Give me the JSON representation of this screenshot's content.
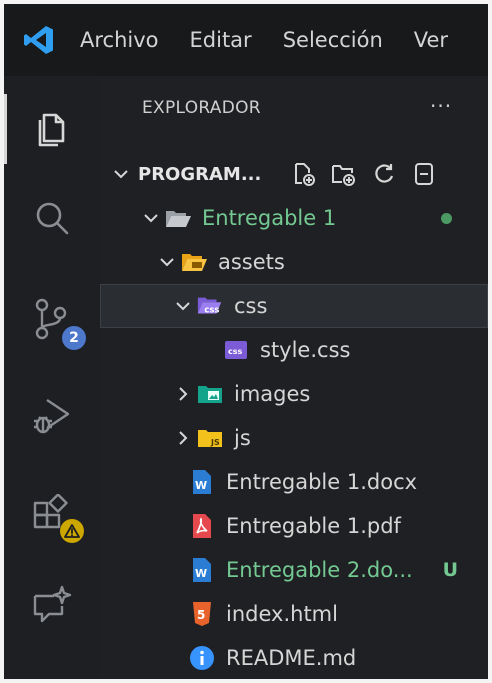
{
  "menubar": {
    "items": [
      "Archivo",
      "Editar",
      "Selección",
      "Ver"
    ]
  },
  "activity_bar": {
    "items": [
      {
        "icon": "explorer-icon",
        "active": true
      },
      {
        "icon": "search-icon"
      },
      {
        "icon": "source-control-icon",
        "badge": "2"
      },
      {
        "icon": "run-debug-icon"
      },
      {
        "icon": "extensions-icon",
        "badge": "!"
      },
      {
        "icon": "chat-icon"
      }
    ]
  },
  "sidebar": {
    "title": "EXPLORADOR",
    "more": "···",
    "section": "PROGRAM...",
    "tree": [
      {
        "name": "Entregable 1",
        "type": "folder-open",
        "depth": 1,
        "git": "dot"
      },
      {
        "name": "assets",
        "type": "folder-open",
        "depth": 2
      },
      {
        "name": "css",
        "type": "folder-css",
        "depth": 3,
        "selected": true
      },
      {
        "name": "style.css",
        "type": "css-file",
        "depth": 4
      },
      {
        "name": "images",
        "type": "folder-images",
        "depth": 3
      },
      {
        "name": "js",
        "type": "folder-js",
        "depth": 3
      },
      {
        "name": "Entregable 1.docx",
        "type": "word-file",
        "depth": 2
      },
      {
        "name": "Entregable 1.pdf",
        "type": "pdf-file",
        "depth": 2
      },
      {
        "name": "Entregable 2.do...",
        "type": "word-file",
        "depth": 2,
        "git": "U"
      },
      {
        "name": "index.html",
        "type": "html-file",
        "depth": 2
      },
      {
        "name": "README.md",
        "type": "info-file",
        "depth": 2
      }
    ]
  },
  "colors": {
    "accent": "#3794ff",
    "git_green": "#73c991",
    "badge_blue": "#4d78cc",
    "warning_yellow": "#cca700"
  }
}
